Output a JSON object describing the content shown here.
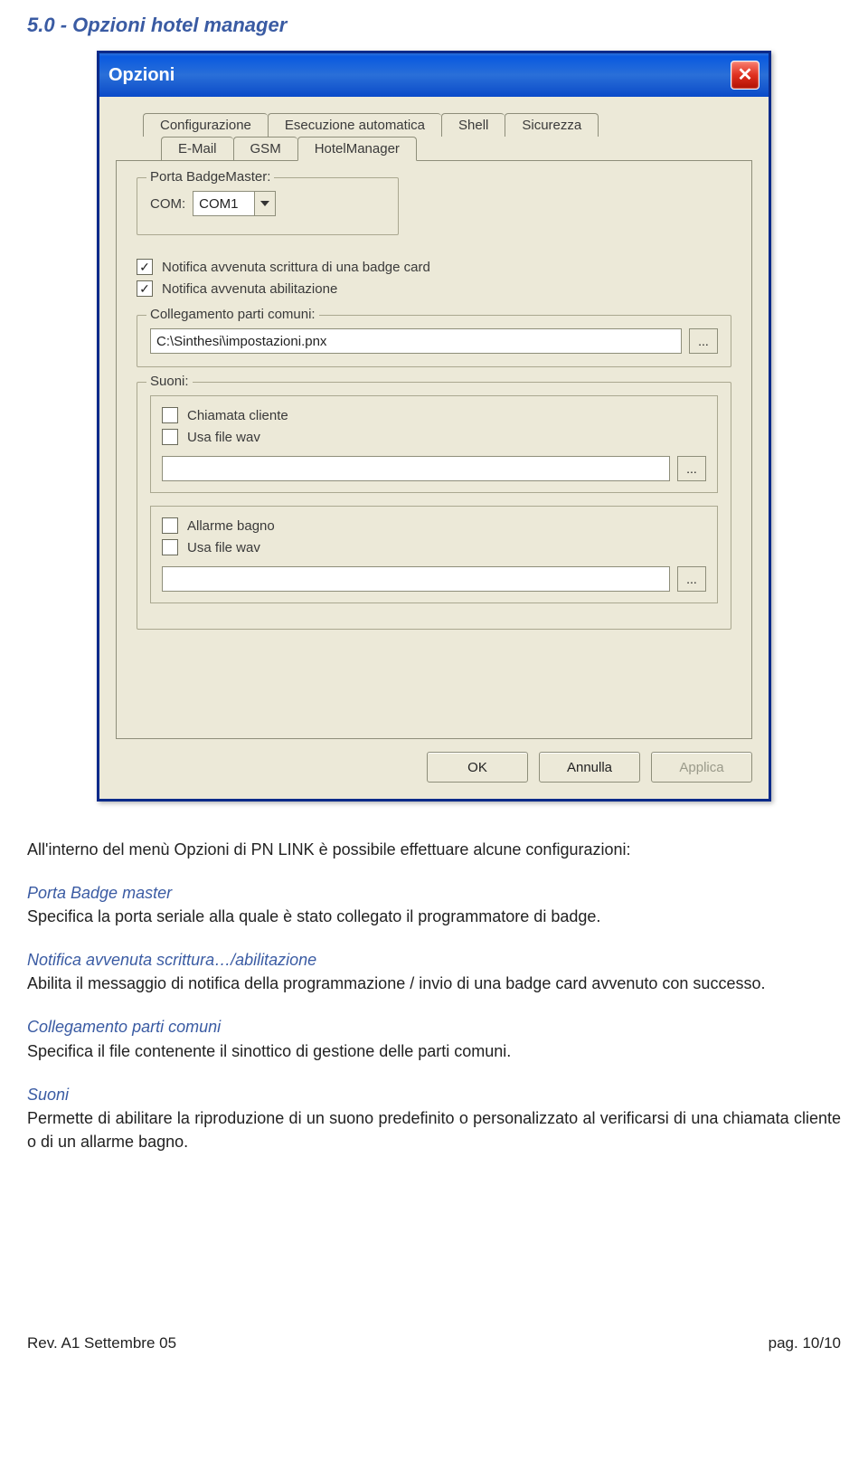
{
  "heading": "5.0 - Opzioni hotel manager",
  "dialog": {
    "title": "Opzioni",
    "tabs_row1": [
      "Configurazione",
      "Esecuzione automatica",
      "Shell",
      "Sicurezza"
    ],
    "tabs_row2": [
      "E-Mail",
      "GSM",
      "HotelManager"
    ],
    "groups": {
      "badge": {
        "legend": "Porta BadgeMaster:",
        "com_label": "COM:",
        "com_value": "COM1"
      },
      "notify_write": "Notifica avvenuta scrittura di una badge card",
      "notify_enable": "Notifica avvenuta abilitazione",
      "link": {
        "legend": "Collegamento parti comuni:",
        "path": "C:\\Sinthesi\\impostazioni.pnx"
      },
      "sounds": {
        "legend": "Suoni:",
        "client_call": "Chiamata cliente",
        "usa_wav1": "Usa file wav",
        "bath_alarm": "Allarme bagno",
        "usa_wav2": "Usa file wav"
      }
    },
    "buttons": {
      "ok": "OK",
      "cancel": "Annulla",
      "apply": "Applica"
    },
    "browse": "..."
  },
  "text": {
    "intro": "All'interno del menù Opzioni di PN LINK è possibile effettuare alcune configurazioni:",
    "h1": "Porta Badge master",
    "p1": "Specifica la porta seriale alla quale è stato collegato il programmatore di badge.",
    "h2": "Notifica avvenuta scrittura…/abilitazione",
    "p2": "Abilita il messaggio di notifica della programmazione / invio di una badge card avvenuto con successo.",
    "h3": "Collegamento parti comuni",
    "p3": "Specifica il file contenente il sinottico di gestione delle parti comuni.",
    "h4": "Suoni",
    "p4": "Permette di abilitare la riproduzione di un suono predefinito o personalizzato al verificarsi di una chiamata cliente o di un allarme bagno."
  },
  "footer": {
    "left": "Rev. A1 Settembre 05",
    "right": "pag. 10/10"
  }
}
